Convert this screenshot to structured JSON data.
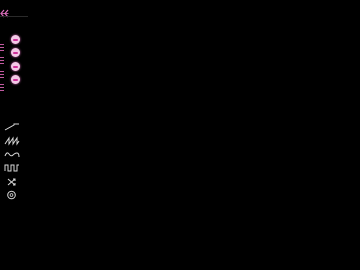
{
  "colors": {
    "background": "#000000",
    "accent": "#e070c0",
    "toggle_fill": "#f3c8e6",
    "icon": "#d8d8d8"
  },
  "header": {
    "back_icon": "double-chevron-left-icon"
  },
  "rows": [
    {
      "handle_icon": "grip-icon",
      "toggle_icon": "toggle-icon",
      "state": "on"
    },
    {
      "handle_icon": "grip-icon",
      "toggle_icon": "toggle-icon",
      "state": "on"
    },
    {
      "handle_icon": "grip-icon",
      "toggle_icon": "toggle-icon",
      "state": "on"
    },
    {
      "handle_icon": "grip-icon",
      "toggle_icon": "toggle-icon",
      "state": "on"
    }
  ],
  "waveforms": [
    {
      "icon": "ramp-wave-icon"
    },
    {
      "icon": "sawtooth-wave-icon"
    },
    {
      "icon": "sine-wave-icon"
    },
    {
      "icon": "square-wave-icon"
    },
    {
      "icon": "random-shuffle-icon"
    },
    {
      "icon": "settings-icon"
    }
  ]
}
